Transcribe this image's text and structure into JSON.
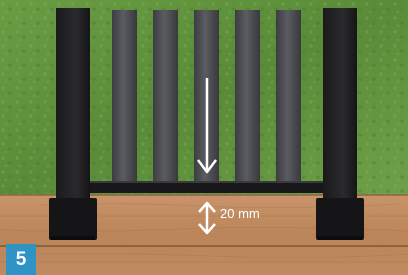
{
  "step": {
    "number": "5"
  },
  "dimension": {
    "label": "20 mm"
  },
  "icons": {
    "drop_arrow": "down-arrow-icon",
    "gap_arrow": "double-vertical-arrow-icon"
  },
  "colors": {
    "grass": "#5f913c",
    "deck_board": "#c08a5e",
    "railing_post": "#1e1e20",
    "baluster": "#4b4c50",
    "bottom_rail": "#18181a",
    "badge": "#2f93c5",
    "annotation": "#ffffff"
  }
}
